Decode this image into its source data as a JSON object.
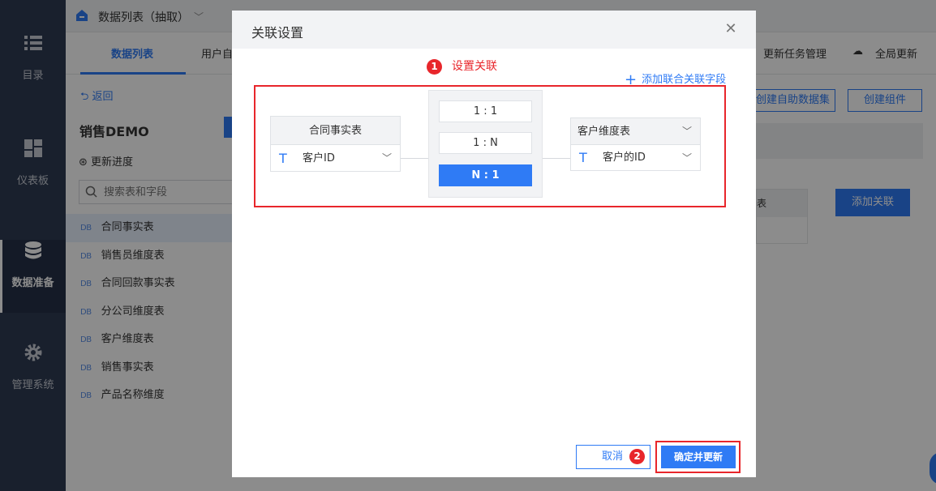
{
  "leftnav": {
    "items": [
      {
        "label": "目录",
        "icon": "list-icon"
      },
      {
        "label": "仪表板",
        "icon": "dashboard-icon"
      },
      {
        "label": "数据准备",
        "icon": "database-icon"
      },
      {
        "label": "管理系统",
        "icon": "gear-icon"
      }
    ]
  },
  "topbar": {
    "title": "数据列表（抽取）"
  },
  "subnav": {
    "tabs": [
      "数据列表",
      "用户自"
    ],
    "actions": [
      "更新任务管理",
      "全局更新"
    ]
  },
  "leftpanel": {
    "back": "返回",
    "title": "销售DEMO",
    "progress": "更新进度",
    "search_placeholder": "搜索表和字段",
    "tables": [
      "合同事实表",
      "销售员维度表",
      "合同回款事实表",
      "分公司维度表",
      "客户维度表",
      "销售事实表",
      "产品名称维度"
    ],
    "db_tag": "DB"
  },
  "main": {
    "create_dataset": "创建自助数据集",
    "create_component": "创建组件",
    "add_relation": "添加关联",
    "table_header_fragment": "表"
  },
  "modal": {
    "title": "关联设置",
    "step1": {
      "badge": "1",
      "text": "设置关联"
    },
    "add_field": "添加联合关联字段",
    "left_table": {
      "name": "合同事实表",
      "field": "客户ID"
    },
    "options": [
      "1 : 1",
      "1 : N",
      "N : 1"
    ],
    "selected_option": "N : 1",
    "right_table": {
      "name": "客户维度表",
      "field": "客户的ID"
    },
    "cancel": "取消",
    "step2": {
      "badge": "2"
    },
    "confirm": "确定并更新"
  },
  "colors": {
    "accent": "#2f7bf5",
    "annotation": "#e8262b",
    "nav_bg": "#2f3b53"
  }
}
